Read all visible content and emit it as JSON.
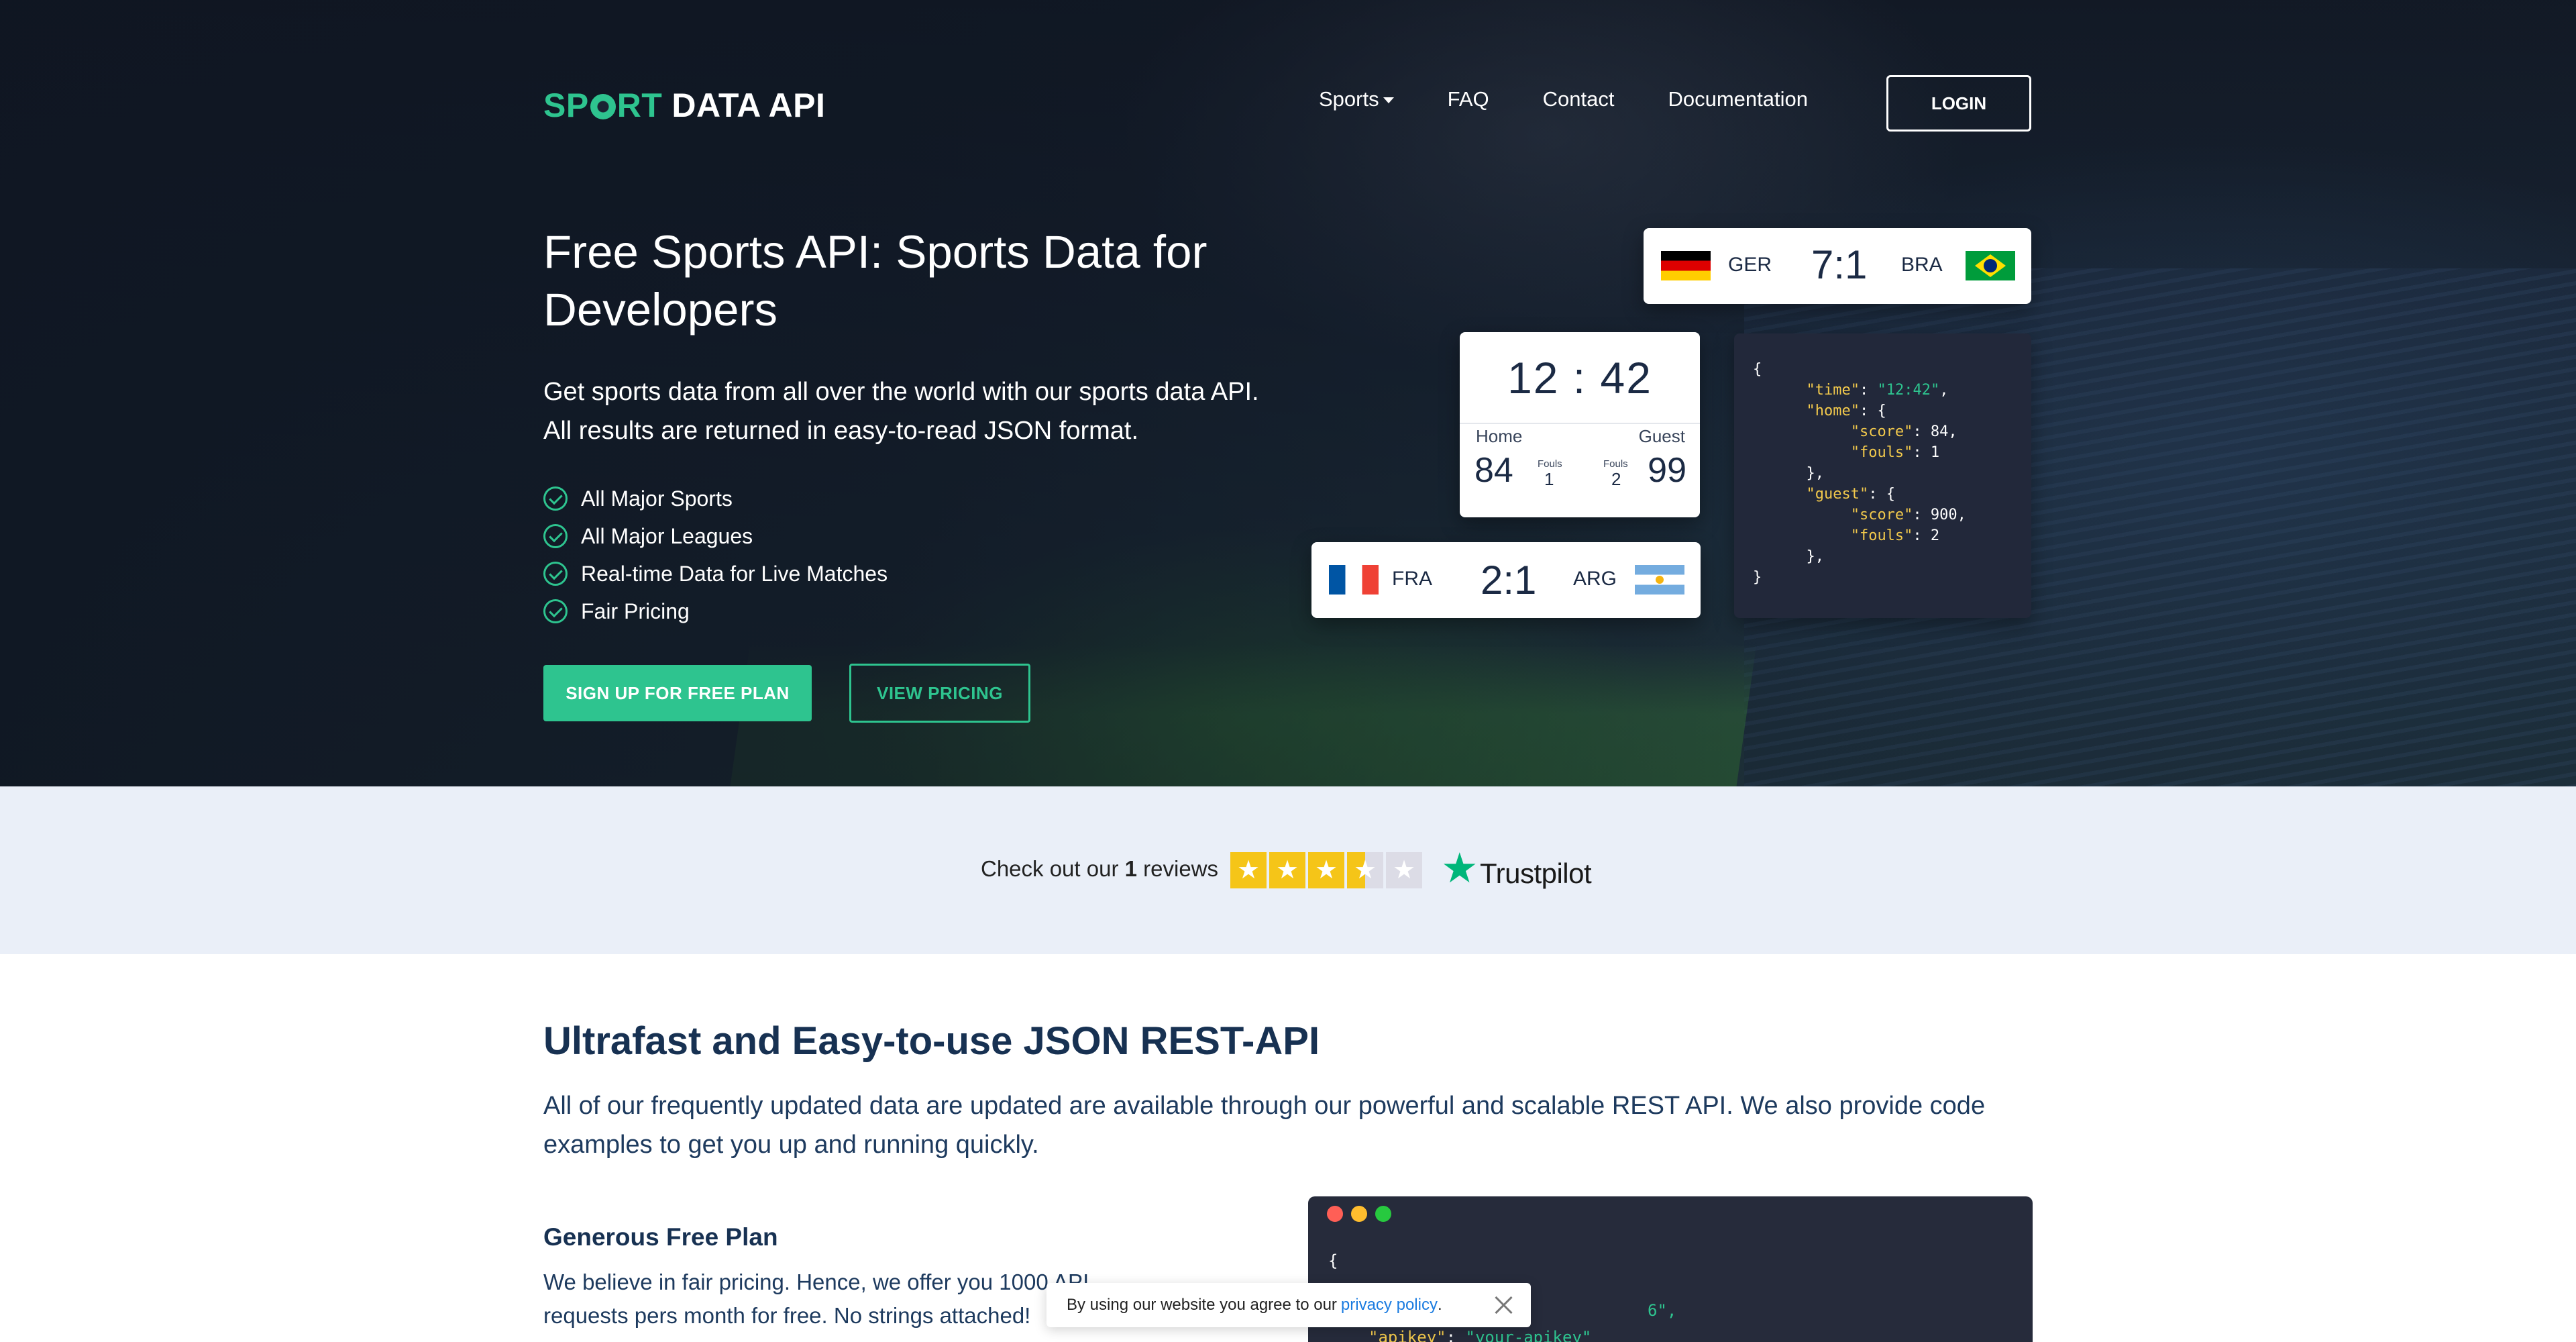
{
  "header": {
    "logo_sport": "SP",
    "logo_rt": "RT",
    "logo_data": "DATA API",
    "nav": [
      "Sports",
      "FAQ",
      "Contact",
      "Documentation"
    ],
    "login_label": "LOGIN"
  },
  "hero": {
    "title": "Free Sports API: Sports Data for Developers",
    "description_1": "Get sports data from all over the world with our sports data API.",
    "description_2": "All results are returned in easy-to-read JSON format.",
    "features": [
      "All Major Sports",
      "All Major Leagues",
      "Real-time Data for Live Matches",
      "Fair Pricing"
    ],
    "signup_label": "SIGN UP FOR FREE PLAN",
    "pricing_label": "VIEW PRICING"
  },
  "scoreboard": {
    "match1": {
      "home": "GER",
      "score": "7:1",
      "away": "BRA"
    },
    "match2": {
      "home": "FRA",
      "score": "2:1",
      "away": "ARG"
    },
    "clock": {
      "time": "12 : 42",
      "home_label": "Home",
      "guest_label": "Guest",
      "home_score": "84",
      "guest_score": "99",
      "fouls_label": "Fouls",
      "home_fouls": "1",
      "guest_fouls": "2"
    },
    "json": {
      "open": "{",
      "time_key": "\"time\"",
      "time_val": "\"12:42\"",
      "home_key": "\"home\"",
      "score_key": "\"score\"",
      "home_score": "84",
      "fouls_key": "\"fouls\"",
      "home_fouls": "1",
      "guest_key": "\"guest\"",
      "guest_score": "900",
      "guest_fouls": "2",
      "close": "}"
    }
  },
  "trust": {
    "text_pre": "Check out our ",
    "count": "1",
    "text_post": " reviews",
    "rating_stars": 3.5,
    "brand": "Trustpilot"
  },
  "content": {
    "title": "Ultrafast and Easy-to-use JSON REST-API",
    "description": "All of our frequently updated data are updated are available through our powerful and scalable REST API. We also provide code examples to get you up and running quickly.",
    "free_plan_title": "Generous Free Plan",
    "free_plan_desc": "We believe in fair pricing. Hence, we offer you 1000 API requests pers month for free. No strings attached!",
    "code_line1": "{",
    "code_line3": "6\",",
    "code_line4_key": "\"apikey\"",
    "code_line4_val": "\"your-apikey\""
  },
  "cookie": {
    "text": "By using our website you agree to our",
    "link": "privacy policy",
    "end": "."
  },
  "colors": {
    "accent": "#2ec48f",
    "hero_bg": "#131a26",
    "trust_bg": "#eaeff8",
    "trustpilot_green": "#00b67a",
    "star_yellow": "#f5c518"
  }
}
